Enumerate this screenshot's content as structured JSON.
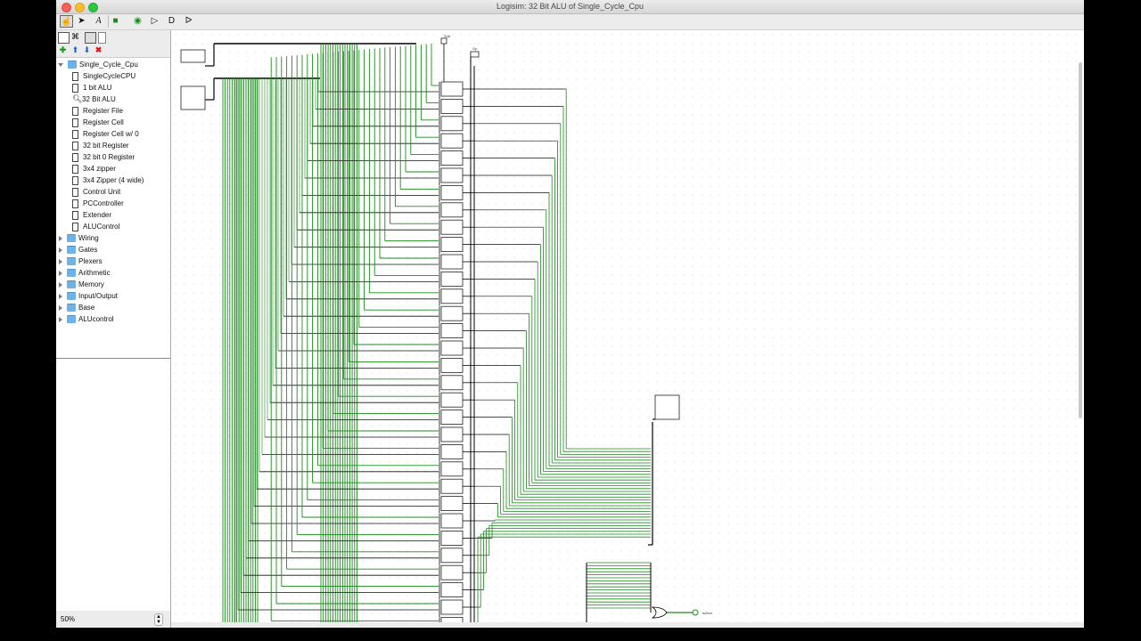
{
  "window": {
    "title": "Logisim: 32 Bit ALU of Single_Cycle_Cpu"
  },
  "toolbar": {
    "tools": [
      {
        "name": "poke-tool",
        "glyph": "☝"
      },
      {
        "name": "select-tool",
        "glyph": "➤"
      },
      {
        "name": "text-tool",
        "glyph": "A"
      },
      {
        "name": "input-pin-tool",
        "glyph": "■"
      },
      {
        "name": "output-pin-tool",
        "glyph": "◉"
      },
      {
        "name": "not-gate-tool",
        "glyph": "▷"
      },
      {
        "name": "and-gate-tool",
        "glyph": "D"
      },
      {
        "name": "or-gate-tool",
        "glyph": "ᐅ"
      }
    ]
  },
  "explorer": {
    "project": "Single_Cycle_Cpu",
    "circuits": [
      "SingleCycleCPU",
      "1 bit ALU",
      "32 Bit ALU",
      "Register File",
      "Register Cell",
      "Register Cell w/ 0",
      "32 bit Register",
      "32 bit 0 Register",
      "3x4 zipper",
      "3x4 Zipper (4 wide)",
      "Control Unit",
      "PCController",
      "Extender",
      "ALUControl"
    ],
    "libraries": [
      "Wiring",
      "Gates",
      "Plexers",
      "Arithmetic",
      "Memory",
      "Input/Output",
      "Base",
      "ALUcontrol"
    ]
  },
  "zoom": {
    "value": "50%"
  },
  "canvas": {
    "probe_labels": [
      "Sub",
      "Op"
    ],
    "alu_count": 32,
    "wire_color": "#1a8c1a",
    "zero_output_label": "isZero"
  }
}
